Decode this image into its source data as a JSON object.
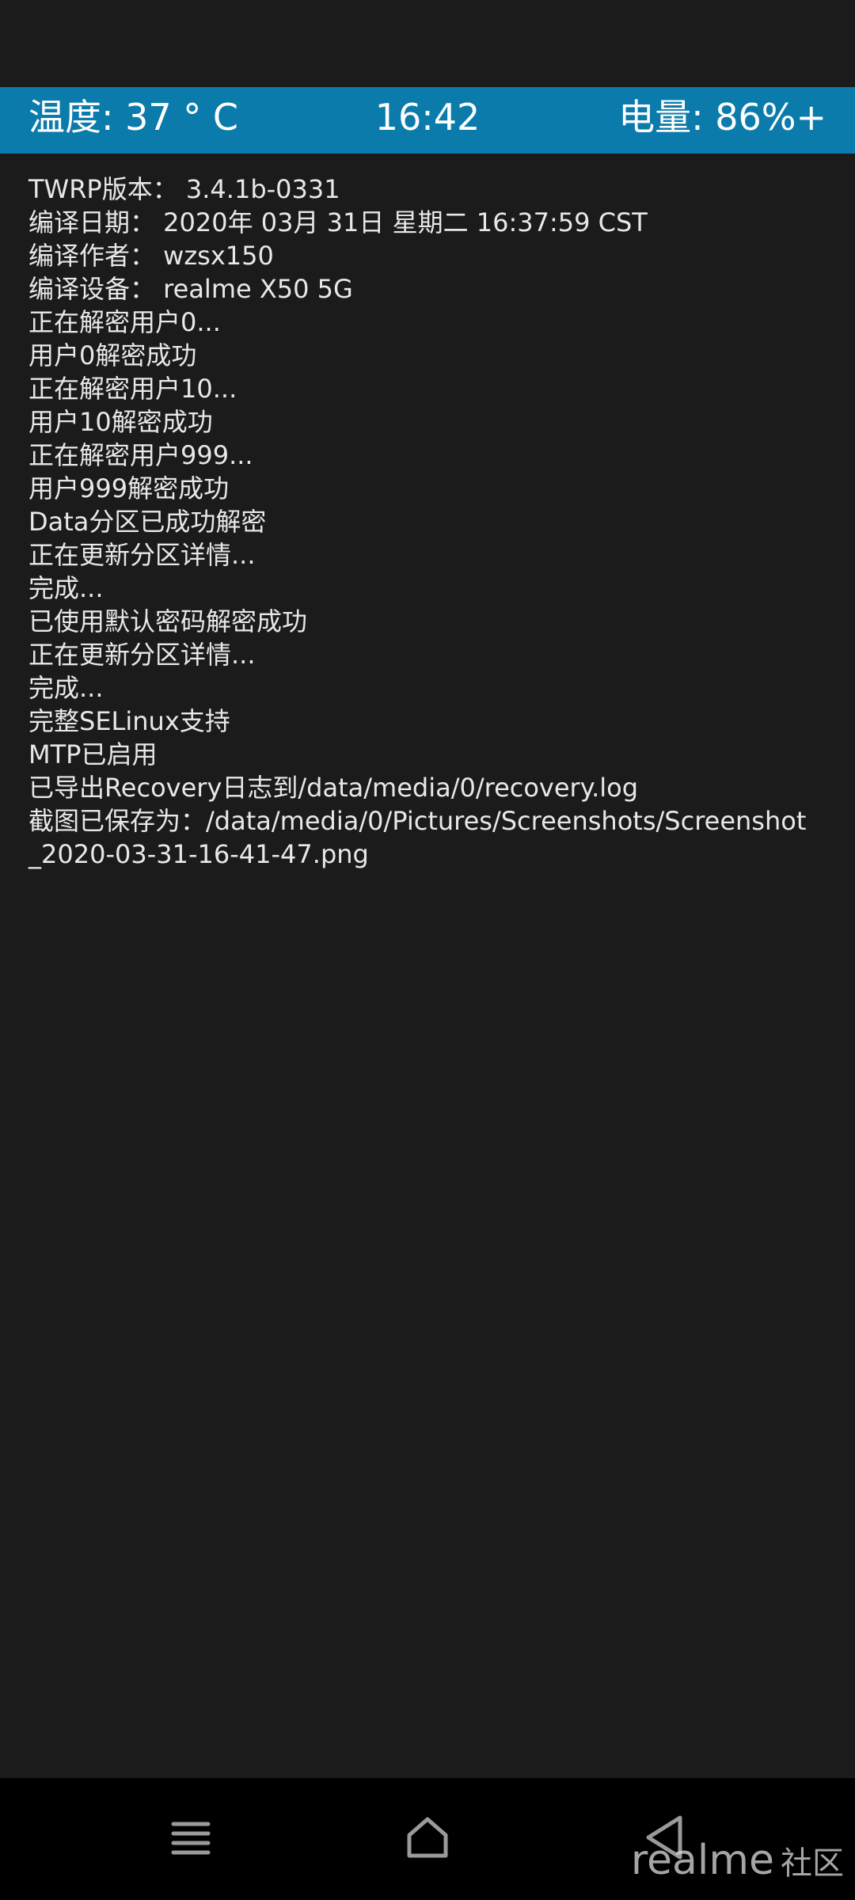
{
  "header": {
    "temperature": "温度: 37 ° C",
    "time": "16:42",
    "battery": "电量: 86%+"
  },
  "console": {
    "lines": [
      "TWRP版本： 3.4.1b-0331",
      "编译日期： 2020年 03月 31日 星期二 16:37:59 CST",
      "编译作者： wzsx150",
      "编译设备： realme X50 5G",
      "正在解密用户0...",
      "用户0解密成功",
      "正在解密用户10...",
      "用户10解密成功",
      "正在解密用户999...",
      "用户999解密成功",
      "Data分区已成功解密",
      "正在更新分区详情...",
      "完成...",
      "已使用默认密码解密成功",
      "正在更新分区详情...",
      "完成...",
      "完整SELinux支持",
      "MTP已启用",
      "已导出Recovery日志到/data/media/0/recovery.log",
      "截图已保存为：/data/media/0/Pictures/Screenshots/Screenshot",
      "_2020-03-31-16-41-47.png"
    ]
  },
  "nav": {
    "menu_icon": "menu-icon",
    "home_icon": "home-icon",
    "back_icon": "back-triangle-icon"
  },
  "watermark": {
    "brand": "realme",
    "community": "社区"
  },
  "colors": {
    "header_bg": "#0a7bab",
    "background": "#1b1b1b",
    "nav_bg": "#000000",
    "text": "#e8e8e8"
  }
}
